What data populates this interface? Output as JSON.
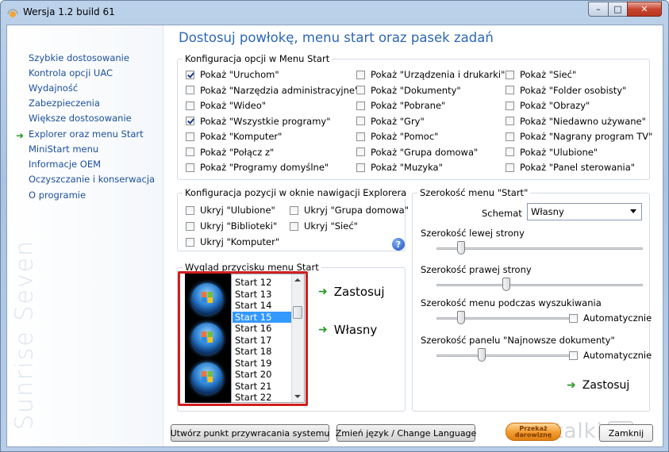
{
  "window": {
    "title": "Wersja 1.2 build 61",
    "controls": {
      "minimize": "–",
      "maximize": "□",
      "close": "✕"
    }
  },
  "sidebar": {
    "items": [
      {
        "label": "Szybkie dostosowanie",
        "active": false
      },
      {
        "label": "Kontrola opcji UAC",
        "active": false
      },
      {
        "label": "Wydajność",
        "active": false
      },
      {
        "label": "Zabezpieczenia",
        "active": false
      },
      {
        "label": "Większe dostosowanie",
        "active": false
      },
      {
        "label": "Explorer oraz menu Start",
        "active": true
      },
      {
        "label": "MiniStart menu",
        "active": false
      },
      {
        "label": "Informacje OEM",
        "active": false
      },
      {
        "label": "Oczyszczanie i konserwacja",
        "active": false
      },
      {
        "label": "O programie",
        "active": false
      }
    ],
    "brand_text": "Sunrise Seven"
  },
  "main": {
    "title": "Dostosuj powłokę, menu start oraz pasek zadań",
    "menu_start_group": {
      "legend": "Konfiguracja opcji w Menu Start",
      "columns": [
        [
          {
            "label": "Pokaż \"Uruchom\"",
            "checked": true
          },
          {
            "label": "Pokaż \"Narzędzia administracyjne\"",
            "checked": false
          },
          {
            "label": "Pokaż \"Wideo\"",
            "checked": false
          },
          {
            "label": "Pokaż \"Wszystkie programy\"",
            "checked": true
          },
          {
            "label": "Pokaż \"Komputer\"",
            "checked": false
          },
          {
            "label": "Pokaż \"Połącz z\"",
            "checked": false
          },
          {
            "label": "Pokaż \"Programy domyślne\"",
            "checked": false
          }
        ],
        [
          {
            "label": "Pokaż \"Urządzenia i drukarki\"",
            "checked": false
          },
          {
            "label": "Pokaż \"Dokumenty\"",
            "checked": false
          },
          {
            "label": "Pokaż \"Pobrane\"",
            "checked": false
          },
          {
            "label": "Pokaż \"Gry\"",
            "checked": false
          },
          {
            "label": "Pokaż \"Pomoc\"",
            "checked": false
          },
          {
            "label": "Pokaż \"Grupa domowa\"",
            "checked": false
          },
          {
            "label": "Pokaż \"Muzyka\"",
            "checked": false
          }
        ],
        [
          {
            "label": "Pokaż \"Sieć\"",
            "checked": false
          },
          {
            "label": "Pokaż \"Folder osobisty\"",
            "checked": false
          },
          {
            "label": "Pokaż \"Obrazy\"",
            "checked": false
          },
          {
            "label": "Pokaż \"Niedawno używane\"",
            "checked": false
          },
          {
            "label": "Pokaż \"Nagrany program TV\"",
            "checked": false
          },
          {
            "label": "Pokaż \"Ulubione\"",
            "checked": false
          },
          {
            "label": "Pokaż \"Panel sterowania\"",
            "checked": false
          }
        ]
      ]
    },
    "explorer_group": {
      "legend": "Konfiguracja pozycji w oknie nawigacji Explorera",
      "items": [
        {
          "label": "Ukryj \"Ulubione\"",
          "checked": false
        },
        {
          "label": "Ukryj \"Grupa domowa\"",
          "checked": false
        },
        {
          "label": "Ukryj \"Biblioteki\"",
          "checked": false
        },
        {
          "label": "Ukryj  \"Sieć\"",
          "checked": false
        },
        {
          "label": "Ukryj \"Komputer\"",
          "checked": false
        }
      ],
      "help": "?"
    },
    "start_button_group": {
      "legend": "Wygląd przycisku menu Start",
      "list_items": [
        "Start 12",
        "Start 13",
        "Start 14",
        "Start 15",
        "Start 16",
        "Start 17",
        "Start 18",
        "Start 19",
        "Start 20",
        "Start 21",
        "Start 22"
      ],
      "selected": "Start 15",
      "apply_label": "Zastosuj",
      "custom_label": "Własny"
    },
    "menu_width_group": {
      "legend": "Szerokość menu \"Start\"",
      "schema_label": "Schemat",
      "schema_value": "Własny",
      "sliders": [
        {
          "label": "Szerokość lewej strony",
          "value": 0.12,
          "auto": null
        },
        {
          "label": "Szerokość prawej strony",
          "value": 0.34,
          "auto": null
        },
        {
          "label": "Szerokość menu podczas wyszukiwania",
          "value": 0.12,
          "auto": "Automatycznie"
        },
        {
          "label": "Szerokość panelu \"Najnowsze dokumenty\"",
          "value": 0.22,
          "auto": "Automatycznie"
        }
      ],
      "apply_label": "Zastosuj"
    }
  },
  "footer": {
    "restore_point": "Utwórz punkt przywracania systemu",
    "change_language": "Zmień język / Change Language",
    "donate_line1": "Przekaż",
    "donate_line2": "darowiznę",
    "close_label": "Zamknij"
  },
  "watermark": {
    "text": "instalki",
    "suffix": "pl"
  },
  "colors": {
    "accent": "#2c67b5",
    "highlight": "#3399ff",
    "red_frame": "#d21e1e",
    "arrow_green": "#2a9a2a"
  }
}
